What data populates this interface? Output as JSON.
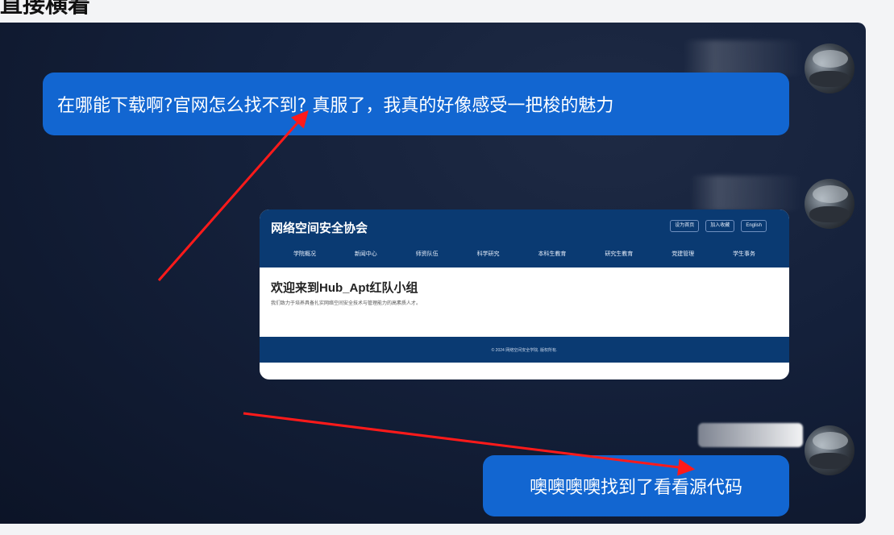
{
  "caption": "直接横着",
  "messages": [
    {
      "text": "在哪能下载啊?官网怎么找不到? 真服了，我真的好像感受一把梭的魅力"
    },
    {
      "text": "噢噢噢噢找到了看看源代码"
    }
  ],
  "card": {
    "title": "网络空间安全协会",
    "buttons": [
      "设为首页",
      "加入收藏",
      "English"
    ],
    "nav": [
      "学院概况",
      "新闻中心",
      "师资队伍",
      "科学研究",
      "本科生教育",
      "研究生教育",
      "党建管理",
      "学生事务"
    ],
    "heading": "欢迎来到Hub_Apt红队小组",
    "description": "我们致力于培养具备扎实网络空间安全技术与管理能力的高素质人才。",
    "footer": "© 2024 网络空间安全学院. 版权所有."
  },
  "colors": {
    "bubble": "#1266d1",
    "card_header": "#0a3a72",
    "arrow": "#ff1a1a"
  }
}
